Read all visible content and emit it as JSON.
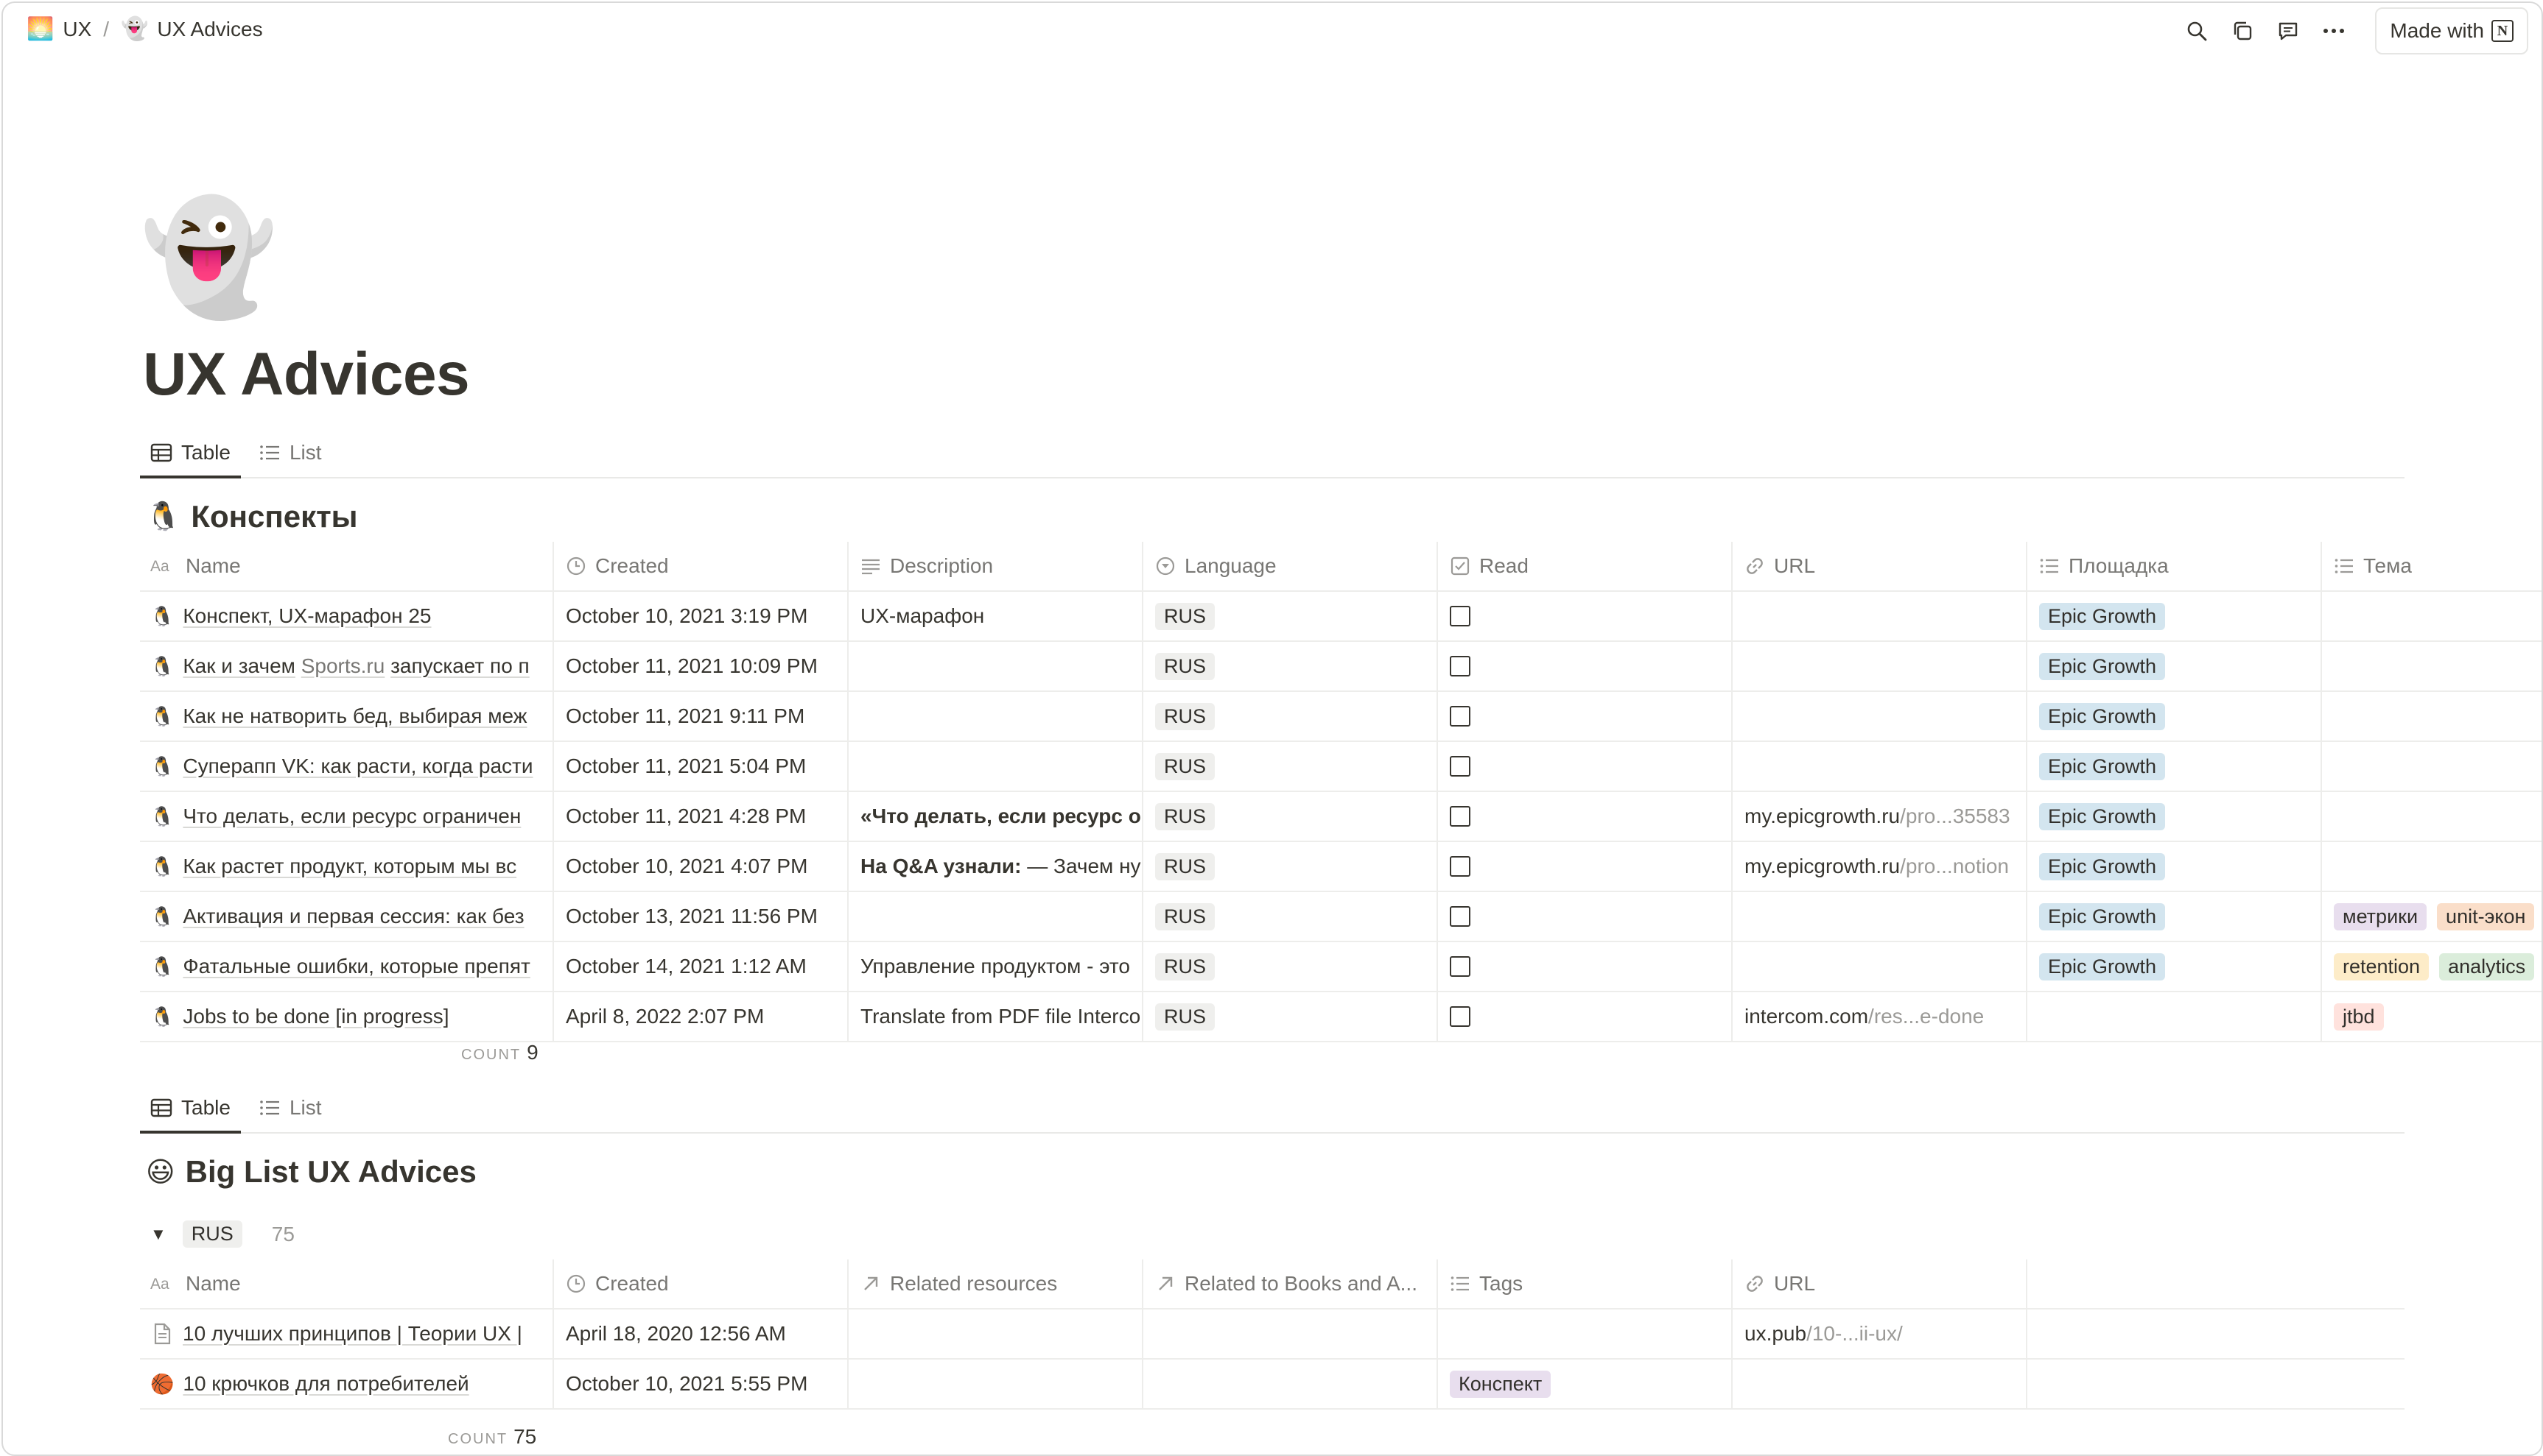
{
  "breadcrumb": [
    {
      "emoji": "🌅",
      "label": "UX"
    },
    {
      "emoji": "👻",
      "label": "UX Advices"
    }
  ],
  "breadcrumb_sep": "/",
  "top_actions": {
    "made_with": "Made with",
    "icons": [
      "search-icon",
      "duplicate-icon",
      "comment-icon",
      "more-icon"
    ]
  },
  "page": {
    "emoji": "👻",
    "title": "UX Advices"
  },
  "views1": [
    {
      "label": "Table",
      "active": true
    },
    {
      "label": "List",
      "active": false
    }
  ],
  "db1": {
    "emoji": "🐧",
    "title": "Конспекты",
    "columns": [
      "Name",
      "Created",
      "Description",
      "Language",
      "Read",
      "URL",
      "Площадка",
      "Тема"
    ],
    "rows": [
      {
        "name": "Конспект, UX-марафон 25",
        "created": "October 10, 2021 3:19 PM",
        "description": "UX-марафон",
        "language": "RUS",
        "url_host": "",
        "url_rest": "",
        "platform": "Epic Growth",
        "topics": []
      },
      {
        "name_pre": "Как и зачем ",
        "name_link": "Sports.ru",
        "name_post": " запускает по п",
        "created": "October 11, 2021 10:09 PM",
        "description": "",
        "language": "RUS",
        "url_host": "",
        "url_rest": "",
        "platform": "Epic Growth",
        "topics": []
      },
      {
        "name": "Как не натворить бед, выбирая меж",
        "created": "October 11, 2021 9:11 PM",
        "description": "",
        "language": "RUS",
        "url_host": "",
        "url_rest": "",
        "platform": "Epic Growth",
        "topics": []
      },
      {
        "name": "Суперапп VK: как расти, когда расти",
        "created": "October 11, 2021 5:04 PM",
        "description": "",
        "language": "RUS",
        "url_host": "",
        "url_rest": "",
        "platform": "Epic Growth",
        "topics": []
      },
      {
        "name": "Что делать, если ресурс ограничен",
        "created": "October 11, 2021 4:28 PM",
        "description_bold": "«Что делать, если ресурс о",
        "language": "RUS",
        "url_host": "my.epicgrowth.ru",
        "url_rest": "/pro...35583",
        "platform": "Epic Growth",
        "topics": []
      },
      {
        "name": "Как растет продукт, которым мы вс",
        "created": "October 10, 2021 4:07 PM",
        "description_bold": "На Q&A узнали:",
        "description_rest": " — Зачем ну",
        "language": "RUS",
        "url_host": "my.epicgrowth.ru",
        "url_rest": "/pro...notion",
        "platform": "Epic Growth",
        "topics": []
      },
      {
        "name": "Активация и первая сессия: как без",
        "created": "October 13, 2021 11:56 PM",
        "description": "",
        "language": "RUS",
        "url_host": "",
        "url_rest": "",
        "platform": "Epic Growth",
        "topics": [
          {
            "label": "метрики",
            "color": "purple"
          },
          {
            "label": "unit-экон",
            "color": "orange"
          }
        ]
      },
      {
        "name": "Фатальные ошибки, которые препят",
        "created": "October 14, 2021 1:12 AM",
        "description": "Управление продуктом - это",
        "language": "RUS",
        "url_host": "",
        "url_rest": "",
        "platform": "Epic Growth",
        "topics": [
          {
            "label": "retention",
            "color": "yellow"
          },
          {
            "label": "analytics",
            "color": "green"
          }
        ]
      },
      {
        "name": "Jobs to be done [in progress]",
        "created": "April 8, 2022 2:07 PM",
        "description": "Translate from PDF file Interco",
        "language": "RUS",
        "url_host": "intercom.com",
        "url_rest": "/res...e-done",
        "platform": "",
        "topics": [
          {
            "label": "jtbd",
            "color": "red"
          }
        ]
      }
    ],
    "count_label": "COUNT",
    "count": "9"
  },
  "views2": [
    {
      "label": "Table",
      "active": true
    },
    {
      "label": "List",
      "active": false
    }
  ],
  "db2": {
    "emoji": "😃",
    "title": "Big List UX Advices",
    "group": {
      "label": "RUS",
      "count": "75"
    },
    "columns": [
      "Name",
      "Created",
      "Related resources",
      "Related to Books and A...",
      "Tags",
      "URL"
    ],
    "rows": [
      {
        "icon": "page",
        "name": "10 лучших принципов | Теории UX |",
        "created": "April 18, 2020 12:56 AM",
        "tag": "",
        "url_host": "ux.pub",
        "url_rest": "/10-...ii-ux/"
      },
      {
        "icon": "🏀",
        "name": "10 крючков для потребителей",
        "created": "October 10, 2021 5:55 PM",
        "tag": "Конспект",
        "url_host": "",
        "url_rest": ""
      }
    ],
    "count_label": "COUNT",
    "count": "75"
  },
  "colors": {
    "text": "#37352f",
    "muted": "#787774",
    "border": "#ededeb",
    "tag_blue": "#d3e5ef"
  }
}
